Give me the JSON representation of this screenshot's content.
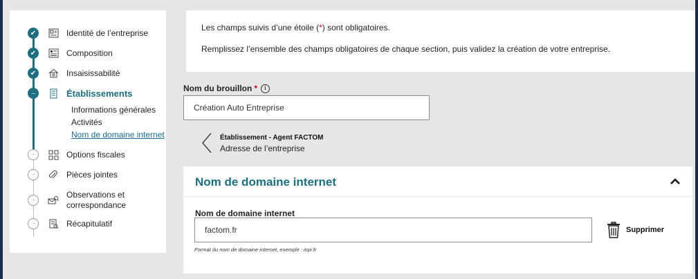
{
  "sidebar": {
    "steps": [
      {
        "label": "Identité de l’entreprise",
        "status": "done",
        "icon": "id-card-icon"
      },
      {
        "label": "Composition",
        "status": "done",
        "icon": "composition-icon"
      },
      {
        "label": "Insaisissabilité",
        "status": "done",
        "icon": "house-icon"
      },
      {
        "label": "Établissements",
        "status": "current",
        "icon": "building-document-icon"
      },
      {
        "label": "Options fiscales",
        "status": "todo",
        "icon": "grid-options-icon"
      },
      {
        "label": "Pièces jointes",
        "status": "todo",
        "icon": "paperclip-icon"
      },
      {
        "label_line1": "Observations et",
        "label_line2": "correspondance",
        "status": "todo",
        "icon": "observation-icon"
      },
      {
        "label": "Récapitulatif",
        "status": "todo",
        "icon": "summary-icon"
      }
    ],
    "substeps": [
      {
        "label": "Informations générales"
      },
      {
        "label": "Activités"
      },
      {
        "label": "Nom de domaine internet",
        "active": true
      }
    ]
  },
  "notice": {
    "line1_before": "Les champs suivis d’une étoile (",
    "line1_star": "*",
    "line1_after": ") sont obligatoires.",
    "line2": "Remplissez l’ensemble des champs obligatoires de chaque section, puis validez la création de votre entreprise."
  },
  "draft": {
    "label": "Nom du brouillon",
    "required_mark": "*",
    "info_icon": "i",
    "value": "Création Auto Entreprise"
  },
  "nav": {
    "title": "Établissement - Agent FACTOM",
    "subtitle": "Adresse de l’entreprise"
  },
  "section": {
    "title": "Nom de domaine internet",
    "field_label": "Nom de domaine internet",
    "field_value": "factom.fr",
    "delete_label": "Supprimer",
    "hint": "Format du nom de domaine internet, exemple : inpi.fr"
  },
  "colors": {
    "accent": "#1c6f80",
    "required": "#d0021b",
    "link": "#1a6e95",
    "outer_frame": "#1a2b4c"
  }
}
